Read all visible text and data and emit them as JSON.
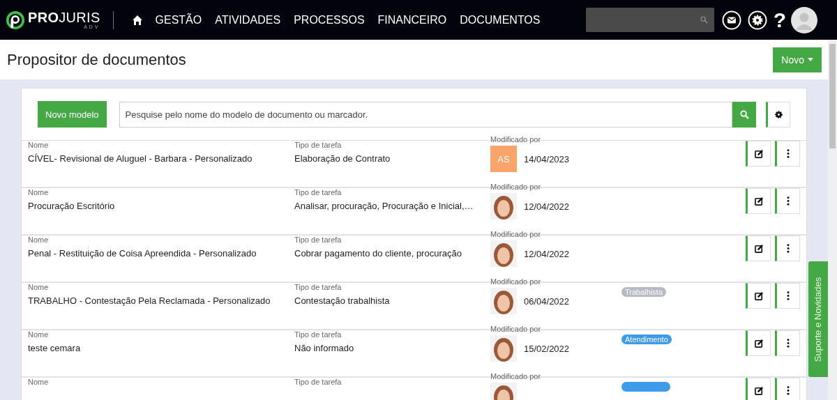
{
  "header": {
    "logo_main": "PRO",
    "logo_rest": "JURIS",
    "logo_sub": "ADV",
    "nav": [
      "GESTÃO",
      "ATIVIDADES",
      "PROCESSOS",
      "FINANCEIRO",
      "DOCUMENTOS"
    ],
    "help": "?"
  },
  "page": {
    "title": "Propositor de documentos",
    "new_button": "Novo"
  },
  "toolbar": {
    "new_model": "Novo modelo",
    "search": {
      "placeholder": "Pesquise pelo nome do modelo de documento ou marcador."
    }
  },
  "rows": [
    {
      "name_label": "Nome",
      "name": "CÍVEL- Revisional de Aluguel - Barbara - Personalizado",
      "type_label": "Tipo de tarefa",
      "type": "Elaboração de Contrato",
      "modified_label": "Modificado por",
      "avatar": {
        "kind": "initials",
        "text": "AS"
      },
      "date": "14/04/2023"
    },
    {
      "name_label": "Nome",
      "name": "Procuração Escritório",
      "type_label": "Tipo de tarefa",
      "type": "Analisar, procuração, Procuração e Inicial,…",
      "modified_label": "Modificado por",
      "avatar": {
        "kind": "photo"
      },
      "date": "12/04/2022"
    },
    {
      "name_label": "Nome",
      "name": "Penal - Restituição de Coisa Apreendida - Personalizado",
      "type_label": "Tipo de tarefa",
      "type": "Cobrar pagamento do cliente, procuração",
      "modified_label": "Modificado por",
      "avatar": {
        "kind": "photo"
      },
      "date": "12/04/2022"
    },
    {
      "name_label": "Nome",
      "name": "TRABALHO - Contestação Pela Reclamada - Personalizado",
      "type_label": "Tipo de tarefa",
      "type": "Contestação trabalhista",
      "modified_label": "Modificado por",
      "avatar": {
        "kind": "photo"
      },
      "date": "06/04/2022",
      "tag": {
        "text": "Trabalhista",
        "color": "#b8b9c6"
      }
    },
    {
      "name_label": "Nome",
      "name": "teste cemara",
      "type_label": "Tipo de tarefa",
      "type": "Não informado",
      "modified_label": "Modificado por",
      "avatar": {
        "kind": "photo"
      },
      "date": "15/02/2022",
      "tag": {
        "text": "Atendimento",
        "color": "#3d9be9"
      }
    },
    {
      "name_label": "Nome",
      "type_label": "Tipo de tarefa",
      "modified_label": "Modificado por",
      "avatar": {
        "kind": "photo"
      },
      "tag": {
        "color": "#3d9be9"
      }
    }
  ],
  "support_tab": "Suporte e Novidades"
}
